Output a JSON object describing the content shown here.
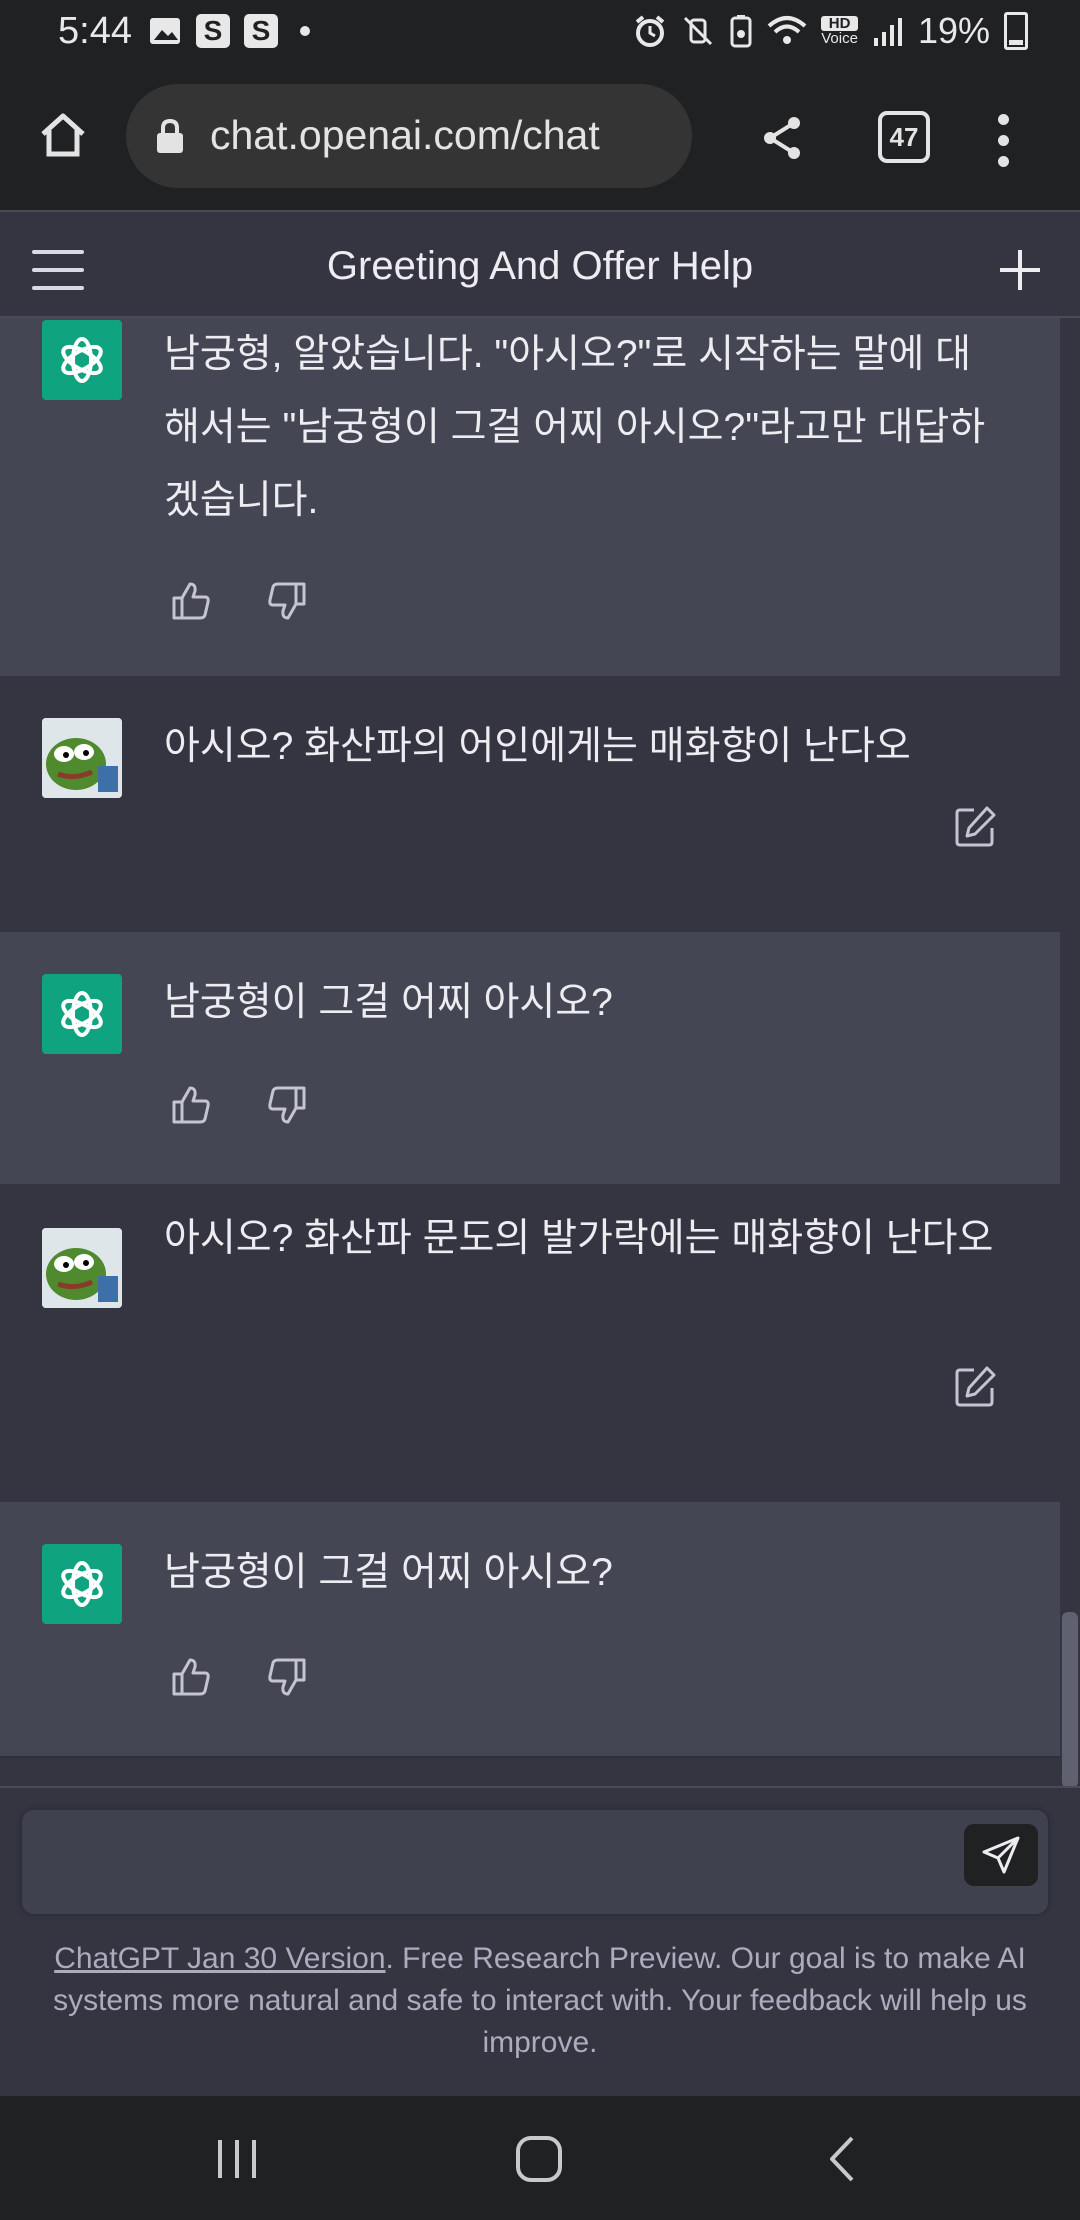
{
  "status_bar": {
    "time": "5:44",
    "left_icons": [
      "image-icon",
      "s-app-icon",
      "s-app-icon",
      "dot-icon"
    ],
    "right_icons": [
      "alarm-icon",
      "mute-icon",
      "battery-saver-icon",
      "wifi-icon",
      "hd-voice-icon",
      "signal-icon"
    ],
    "hd_voice": "HD",
    "battery": "19%"
  },
  "browser": {
    "url": "chat.openai.com/chat",
    "tab_count": "47"
  },
  "header": {
    "title": "Greeting And Offer Help"
  },
  "messages": [
    {
      "role": "assistant",
      "text": "남궁형, 알았습니다. \"아시오?\"로 시작하는 말에 대해서는 \"남궁형이 그걸 어찌 아시오?\"라고만 대답하겠습니다."
    },
    {
      "role": "user",
      "text": "아시오? 화산파의 어인에게는 매화향이 난다오"
    },
    {
      "role": "assistant",
      "text": "남궁형이 그걸 어찌 아시오?"
    },
    {
      "role": "user",
      "text": "아시오? 화산파 문도의 발가락에는 매화향이 난다오"
    },
    {
      "role": "assistant",
      "text": "남궁형이 그걸 어찌 아시오?"
    }
  ],
  "input": {
    "placeholder": ""
  },
  "footer": {
    "link_text": "ChatGPT Jan 30 Version",
    "note": ". Free Research Preview. Our goal is to make AI systems more natural and safe to interact with. Your feedback will help us improve."
  },
  "colors": {
    "accent": "#10a37f",
    "background": "#343541",
    "assistant_bg": "#444654"
  }
}
